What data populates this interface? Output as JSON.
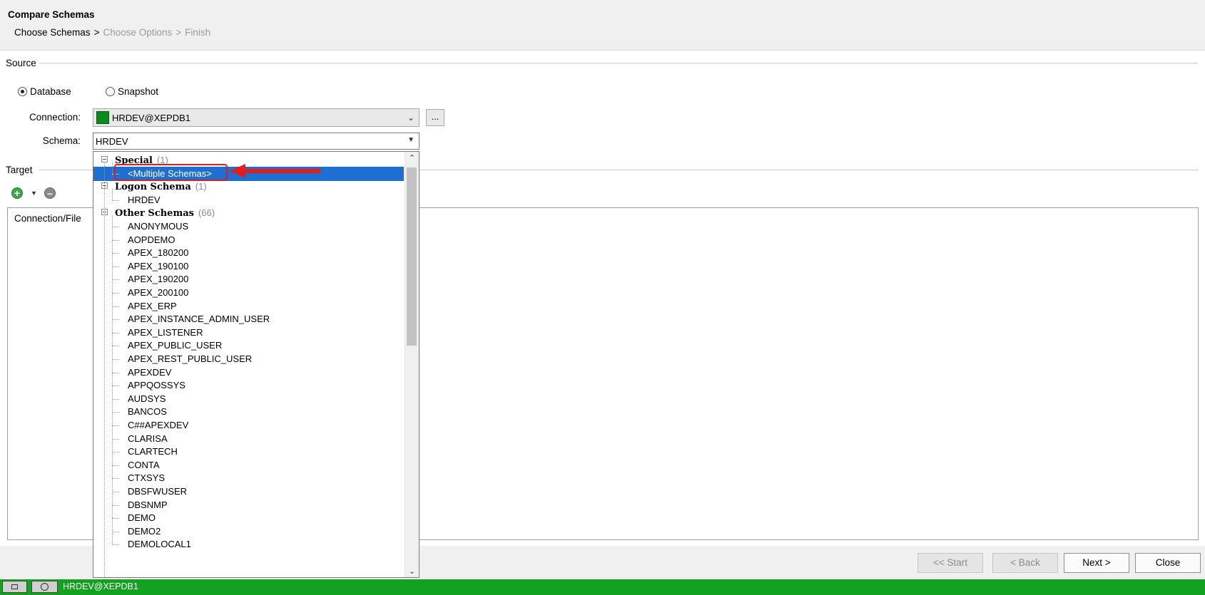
{
  "header": {
    "title": "Compare Schemas",
    "breadcrumb": {
      "step1": "Choose Schemas",
      "step2": "Choose Options",
      "step3": "Finish",
      "separator": ">"
    }
  },
  "source": {
    "section_label": "Source",
    "radio_database": "Database",
    "radio_snapshot": "Snapshot",
    "selected_radio": "Database",
    "connection_label": "Connection:",
    "connection_value": "HRDEV@XEPDB1",
    "browse_label": "...",
    "schema_label": "Schema:",
    "schema_value": "HRDEV"
  },
  "target": {
    "section_label": "Target",
    "column_header": "Connection/File"
  },
  "dropdown": {
    "groups": [
      {
        "title": "Special",
        "count": "(1)",
        "items": [
          "<Multiple Schemas>"
        ]
      },
      {
        "title": "Logon Schema",
        "count": "(1)",
        "items": [
          "HRDEV"
        ]
      },
      {
        "title": "Other Schemas",
        "count": "(66)",
        "items": [
          "ANONYMOUS",
          "AOPDEMO",
          "APEX_180200",
          "APEX_190100",
          "APEX_190200",
          "APEX_200100",
          "APEX_ERP",
          "APEX_INSTANCE_ADMIN_USER",
          "APEX_LISTENER",
          "APEX_PUBLIC_USER",
          "APEX_REST_PUBLIC_USER",
          "APEXDEV",
          "APPQOSSYS",
          "AUDSYS",
          "BANCOS",
          "C##APEXDEV",
          "CLARISA",
          "CLARTECH",
          "CONTA",
          "CTXSYS",
          "DBSFWUSER",
          "DBSNMP",
          "DEMO",
          "DEMO2",
          "DEMOLOCAL1"
        ]
      }
    ],
    "selected_item": "<Multiple Schemas>"
  },
  "footer": {
    "start_label": "<< Start",
    "back_label": "< Back",
    "next_label": "Next >",
    "close_label": "Close"
  },
  "status_bar": {
    "connection": "HRDEV@XEPDB1"
  },
  "colors": {
    "connection_swatch": "#0b8a1e",
    "status_bar": "#13a21f",
    "selection": "#1f6fd1",
    "annotation": "#e31c1c"
  }
}
